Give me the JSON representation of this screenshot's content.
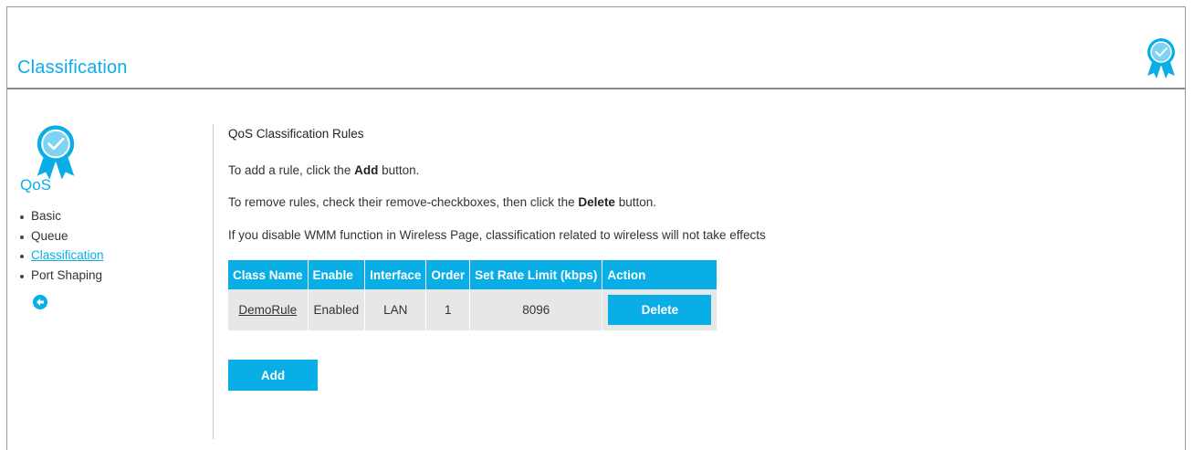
{
  "header": {
    "title": "Classification",
    "badge_icon": "ribbon-badge-icon"
  },
  "sidebar": {
    "title": "QoS",
    "badge_icon": "ribbon-badge-icon",
    "items": [
      {
        "label": "Basic",
        "active": false
      },
      {
        "label": "Queue",
        "active": false
      },
      {
        "label": "Classification",
        "active": true
      },
      {
        "label": "Port Shaping",
        "active": false
      }
    ],
    "back_icon": "back-arrow-icon"
  },
  "main": {
    "section_title": "QoS Classification Rules",
    "instruction_add": {
      "pre": "To add a rule, click the ",
      "bold": "Add",
      "post": " button."
    },
    "instruction_remove": {
      "pre": "To remove rules, check their remove-checkboxes, then click the ",
      "bold": "Delete",
      "post": " button."
    },
    "note": "If you disable WMM function in Wireless Page, classification related to wireless will not take effects",
    "table": {
      "headers": [
        "Class Name",
        "Enable",
        "Interface",
        "Order",
        "Set Rate Limit (kbps)",
        "Action"
      ],
      "rows": [
        {
          "class_name": "DemoRule",
          "enable": "Enabled",
          "interface": "LAN",
          "order": "1",
          "rate_limit": "8096",
          "action_label": "Delete"
        }
      ]
    },
    "add_label": "Add"
  },
  "colors": {
    "accent": "#0aaee6",
    "row_background": "#e7e7e7",
    "header_rule": "#8a8a8a"
  }
}
